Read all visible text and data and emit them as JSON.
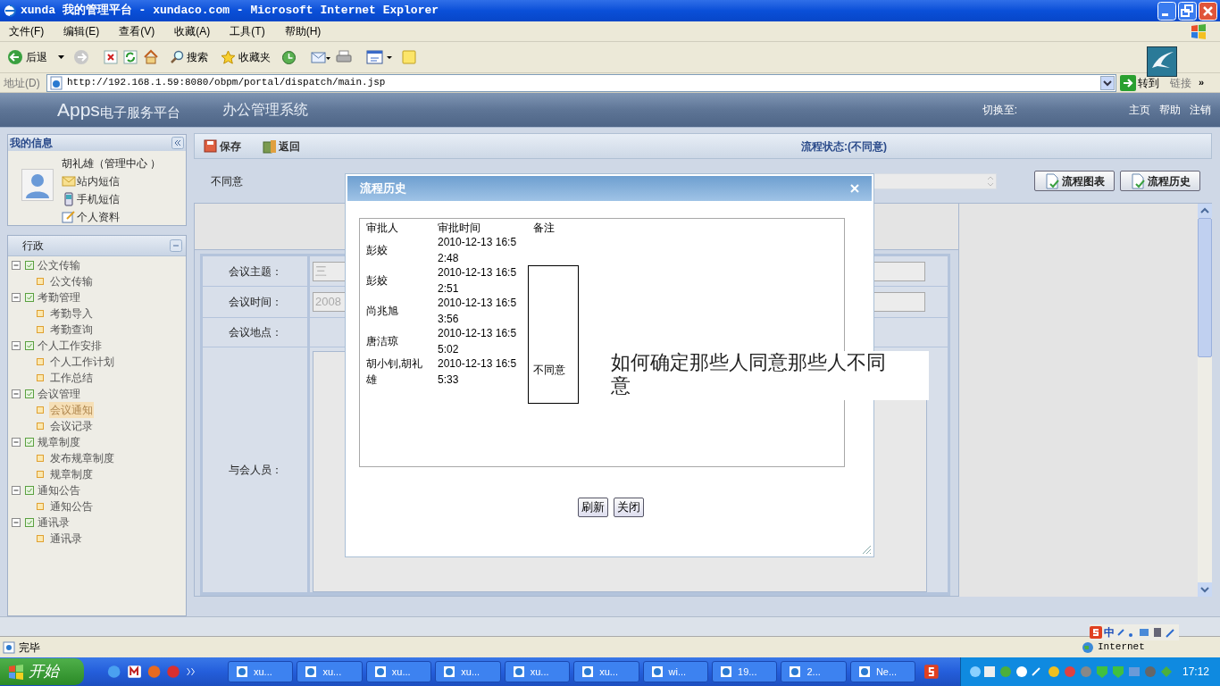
{
  "window": {
    "title": "xunda 我的管理平台 - xundaco.com - Microsoft Internet Explorer"
  },
  "menu": [
    "文件(F)",
    "编辑(E)",
    "查看(V)",
    "收藏(A)",
    "工具(T)",
    "帮助(H)"
  ],
  "toolbar": {
    "back": "后退",
    "search": "搜索",
    "favorites": "收藏夹"
  },
  "address": {
    "label": "地址(D)",
    "url": "http://192.168.1.59:8080/obpm/portal/dispatch/main.jsp",
    "go": "转到",
    "links": "链接",
    "more": "»"
  },
  "app_header": {
    "logo": "Apps",
    "logo_sub": "电子服务平台",
    "system": "办公管理系统",
    "switch": "切换至:",
    "links": [
      "主页",
      "帮助",
      "注销"
    ]
  },
  "sidebar": {
    "title": "我的信息",
    "user": "胡礼雄（管理中心 ）",
    "links": [
      "站内短信",
      "手机短信",
      "个人资料"
    ],
    "section": "行政",
    "tree": [
      {
        "label": "公文传输",
        "expanded": true,
        "children": [
          {
            "label": "公文传输",
            "selected": false
          }
        ]
      },
      {
        "label": "考勤管理",
        "expanded": true,
        "children": [
          {
            "label": "考勤导入",
            "selected": false
          },
          {
            "label": "考勤查询",
            "selected": false
          }
        ]
      },
      {
        "label": "个人工作安排",
        "expanded": true,
        "children": [
          {
            "label": "个人工作计划",
            "selected": false
          },
          {
            "label": "工作总结",
            "selected": false
          }
        ]
      },
      {
        "label": "会议管理",
        "expanded": true,
        "children": [
          {
            "label": "会议通知",
            "selected": true
          },
          {
            "label": "会议记录",
            "selected": false
          }
        ]
      },
      {
        "label": "规章制度",
        "expanded": true,
        "children": [
          {
            "label": "发布规章制度",
            "selected": false
          },
          {
            "label": "规章制度",
            "selected": false
          }
        ]
      },
      {
        "label": "通知公告",
        "expanded": true,
        "children": [
          {
            "label": "通知公告",
            "selected": false
          }
        ]
      },
      {
        "label": "通讯录",
        "expanded": true,
        "children": [
          {
            "label": "通讯录",
            "selected": false
          }
        ]
      }
    ]
  },
  "form": {
    "actions": [
      "保存",
      "返回"
    ],
    "status": "流程状态:(不同意)",
    "opinion": "不同意",
    "flow_buttons": [
      "流程图表",
      "流程历史"
    ],
    "fields": [
      {
        "label": "会议主题：",
        "value": "三"
      },
      {
        "label": "会议时间：",
        "value": "2008"
      },
      {
        "label": "会议地点："
      },
      {
        "label": "与会人员："
      }
    ]
  },
  "dialog": {
    "title": "流程历史",
    "columns": [
      "审批人",
      "审批时间",
      "备注"
    ],
    "rows": [
      {
        "approver": "彭姣",
        "time": "2010-12-13 16:52:48"
      },
      {
        "approver": "彭姣",
        "time": "2010-12-13 16:52:51"
      },
      {
        "approver": "尚兆旭",
        "time": "2010-12-13 16:53:56"
      },
      {
        "approver": "唐洁琼",
        "time": "2010-12-13 16:55:02"
      },
      {
        "approver": "胡小钊,胡礼雄",
        "time": "2010-12-13 16:55:33"
      }
    ],
    "note_box": "不同意",
    "buttons": [
      "刷新",
      "关闭"
    ]
  },
  "annotation": "如何确定那些人同意那些人不同意",
  "status_bar": {
    "text": "完毕",
    "zone": "Internet",
    "ime": "中"
  },
  "taskbar": {
    "start": "开始",
    "tasks": [
      "xu...",
      "xu...",
      "xu...",
      "xu...",
      "xu...",
      "xu...",
      "wi...",
      "19...",
      "2...",
      "Ne..."
    ],
    "clock": "17:12"
  }
}
